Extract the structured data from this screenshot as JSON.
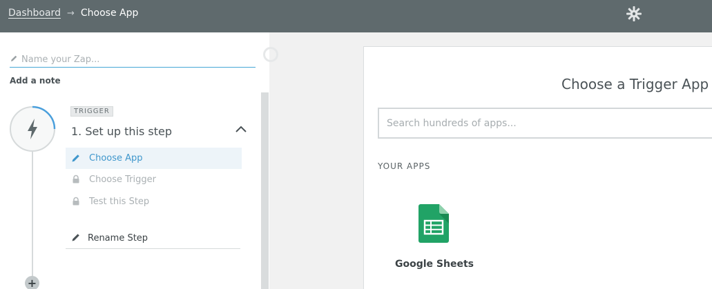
{
  "header": {
    "breadcrumb_link": "Dashboard",
    "breadcrumb_separator": "→",
    "breadcrumb_current": "Choose App",
    "settings_icon": "gear-icon"
  },
  "zap": {
    "name_placeholder": "Name your Zap...",
    "add_note": "Add a note"
  },
  "step": {
    "badge": "TRIGGER",
    "title": "1. Set up this step",
    "icon": "lightning-icon",
    "substeps": [
      {
        "label": "Choose App",
        "state": "active",
        "icon": "pencil-icon"
      },
      {
        "label": "Choose Trigger",
        "state": "locked",
        "icon": "lock-icon"
      },
      {
        "label": "Test this Step",
        "state": "locked",
        "icon": "lock-icon"
      }
    ],
    "rename_label": "Rename Step",
    "add_step_symbol": "+"
  },
  "main": {
    "title": "Choose a Trigger App",
    "search_placeholder": "Search hundreds of apps...",
    "section_label": "YOUR APPS",
    "apps": [
      {
        "name": "Google Sheets",
        "icon": "google-sheets-icon",
        "color": "#21a366"
      }
    ]
  },
  "colors": {
    "topbar": "#5f6a6d",
    "accent": "#3f97cc",
    "progress_ring": "#4a9fdc"
  }
}
